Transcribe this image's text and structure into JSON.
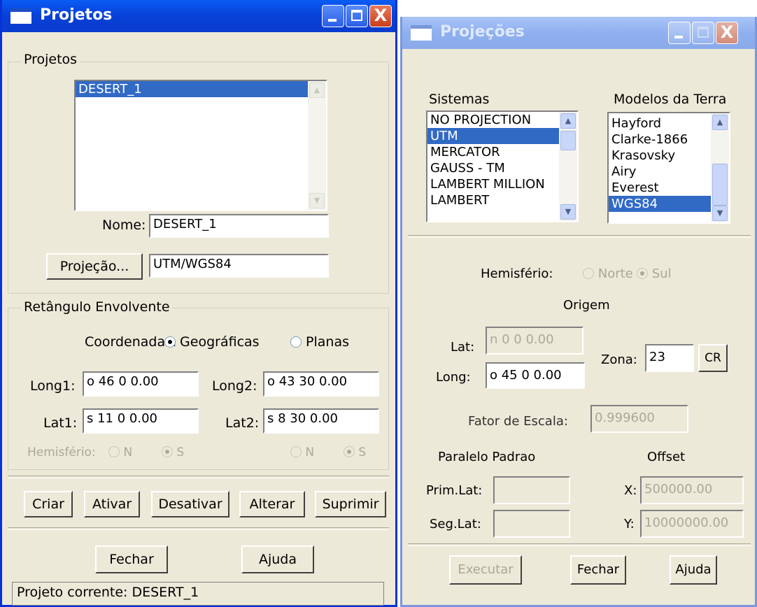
{
  "projetos_window": {
    "title": "Projetos",
    "close_glyph": "X",
    "group_projetos": "Projetos",
    "projects_list": [
      {
        "label": "DESERT_1",
        "selected": true
      }
    ],
    "nome_label": "Nome:",
    "nome_value": "DESERT_1",
    "projecao_button": "Projeção...",
    "projecao_value": "UTM/WGS84",
    "group_retangulo": "Retângulo Envolvente",
    "coordenadas_label": "Coordenadas:",
    "coord_geograficas": "Geográficas",
    "coord_planas": "Planas",
    "long1_label": "Long1:",
    "long1_value": "o 46  0  0.00",
    "long2_label": "Long2:",
    "long2_value": "o 43  30  0.00",
    "lat1_label": "Lat1:",
    "lat1_value": "s 11  0  0.00",
    "lat2_label": "Lat2:",
    "lat2_value": "s 8   30  0.00",
    "hemisferio_label": "Hemisfério:",
    "hem_n": "N",
    "hem_s": "S",
    "buttons": {
      "criar": "Criar",
      "ativar": "Ativar",
      "desativar": "Desativar",
      "alterar": "Alterar",
      "suprimir": "Suprimir",
      "fechar": "Fechar",
      "ajuda": "Ajuda"
    },
    "status": "Projeto corrente: DESERT_1"
  },
  "projecoes_window": {
    "title": "Projeções",
    "close_glyph": "X",
    "sistemas_label": "Sistemas",
    "sistemas": [
      {
        "label": "NO PROJECTION",
        "selected": false
      },
      {
        "label": "UTM",
        "selected": true
      },
      {
        "label": "MERCATOR",
        "selected": false
      },
      {
        "label": "GAUSS - TM",
        "selected": false
      },
      {
        "label": "LAMBERT MILLION",
        "selected": false
      },
      {
        "label": "LAMBERT",
        "selected": false
      }
    ],
    "modelos_label": "Modelos da Terra",
    "modelos": [
      {
        "label": "Hayford",
        "selected": false
      },
      {
        "label": "Clarke-1866",
        "selected": false
      },
      {
        "label": "Krasovsky",
        "selected": false
      },
      {
        "label": "Airy",
        "selected": false
      },
      {
        "label": "Everest",
        "selected": false
      },
      {
        "label": "WGS84",
        "selected": true
      }
    ],
    "hemisferio_label": "Hemisfério:",
    "hem_norte": "Norte",
    "hem_sul": "Sul",
    "origem_label": "Origem",
    "lat_label": "Lat:",
    "lat_value": "n 0 0 0.00",
    "long_label": "Long:",
    "long_value": "o 45  0   0.00",
    "zona_label": "Zona:",
    "zona_value": "23",
    "cr_button": "CR",
    "fator_label": "Fator de Escala:",
    "fator_value": "0.999600",
    "paralelo_label": "Paralelo Padrao",
    "offset_label": "Offset",
    "prim_lat_label": "Prim.Lat:",
    "seg_lat_label": "Seg.Lat:",
    "x_label": "X:",
    "x_value": "500000.00",
    "y_label": "Y:",
    "y_value": "10000000.00",
    "buttons": {
      "executar": "Executar",
      "fechar": "Fechar",
      "ajuda": "Ajuda"
    }
  }
}
